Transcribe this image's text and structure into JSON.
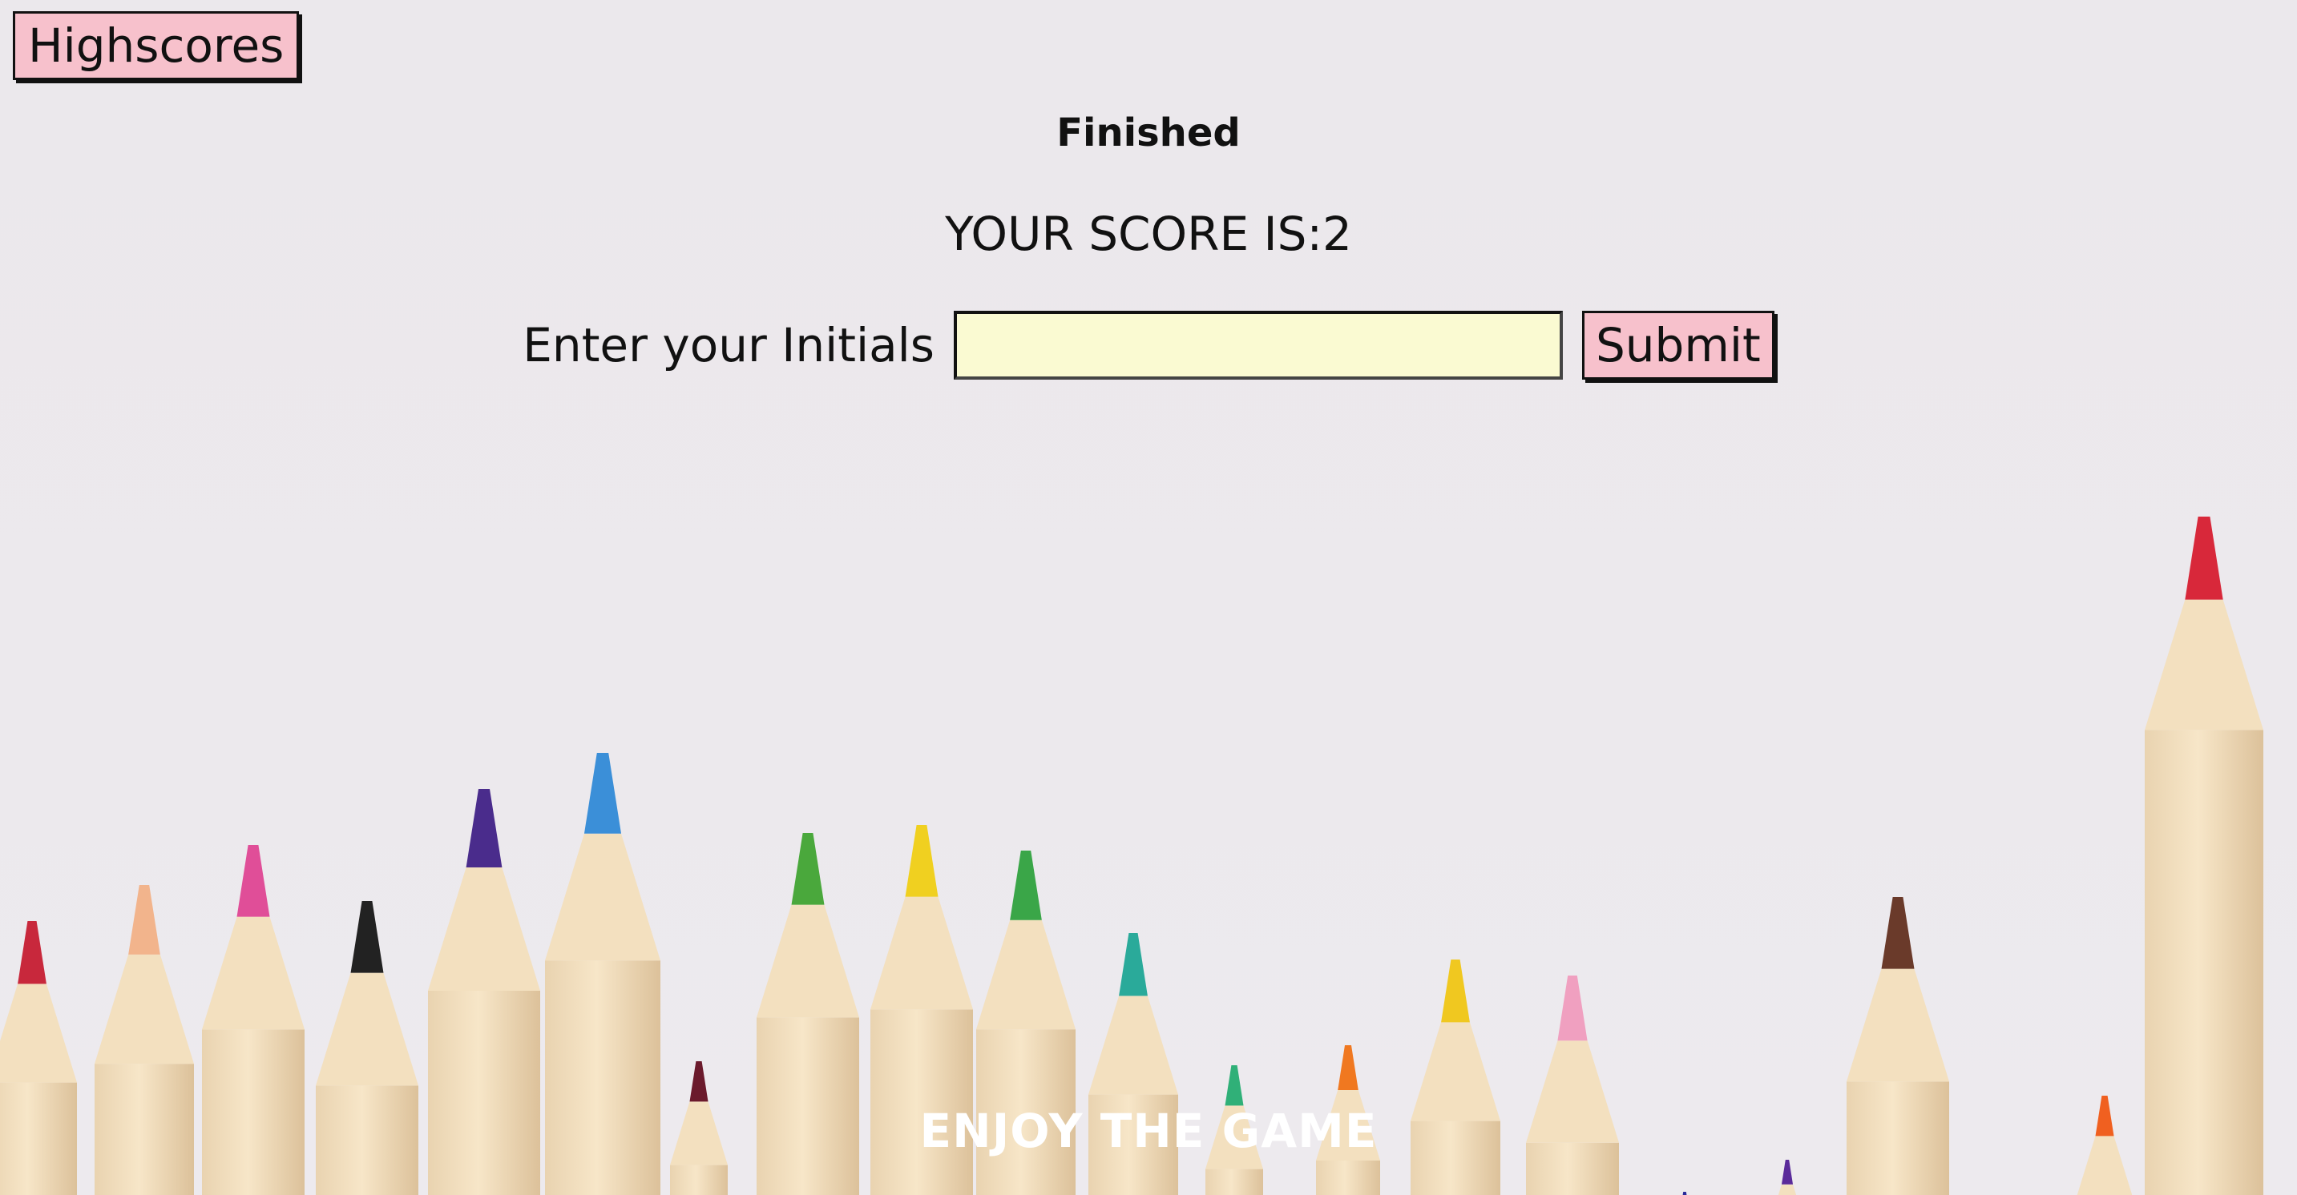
{
  "header": {
    "highscores_label": "Highscores"
  },
  "main": {
    "status_title": "Finished",
    "score_text": "YOUR SCORE IS:2",
    "initials_label": "Enter your Initials",
    "initials_value": "",
    "submit_label": "Submit"
  },
  "footer": {
    "tagline": "ENJOY THE GAME"
  },
  "colors": {
    "background": "#ebe8ec",
    "button_bg": "#f7c1cc",
    "input_bg": "#fafad2",
    "footer_text": "#ffffff"
  },
  "background_image": {
    "subject": "colored-pencils-icon",
    "pencil_tip_colors": [
      "#c8283c",
      "#f2b48c",
      "#e04e98",
      "#222222",
      "#4a2c8c",
      "#3b8fd8",
      "#6b1a2c",
      "#4aa83c",
      "#f0d020",
      "#3aa648",
      "#2aaa9a",
      "#30b078",
      "#f07820",
      "#f0c820",
      "#f0a0c0",
      "#2a2a9a",
      "#5a2a9a",
      "#6a3a2a",
      "#f06020",
      "#d8283a"
    ]
  }
}
